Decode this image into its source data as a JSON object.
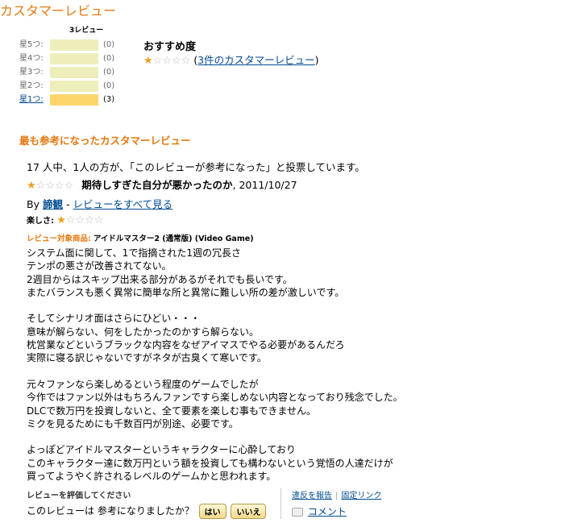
{
  "page": {
    "title": "カスタマーレビュー",
    "helpful_title": "最も参考になったカスタマーレビュー"
  },
  "histogram": {
    "header": "3レビュー",
    "rows": [
      {
        "label": "星5つ:",
        "count": "(0)",
        "fraction": 0
      },
      {
        "label": "星4つ:",
        "count": "(0)",
        "fraction": 0
      },
      {
        "label": "星3つ:",
        "count": "(0)",
        "fraction": 0
      },
      {
        "label": "星2つ:",
        "count": "(0)",
        "fraction": 0
      },
      {
        "label": "星1つ:",
        "count": "(3)",
        "fraction": 1
      }
    ]
  },
  "recommendation": {
    "title": "おすすめ度",
    "stars": 1,
    "max_stars": 5,
    "open_paren": "(",
    "link": "3件のカスタマーレビュー",
    "close_paren": ")"
  },
  "review": {
    "vote_summary": "17 人中、1人の方が、「このレビューが参考になった」と投票しています。",
    "stars": 1,
    "title": "期待しすぎた自分が悪かったのか",
    "date": ", 2011/10/27",
    "by": "By",
    "author": "諦観",
    "dash": " - ",
    "all_reviews_link": "レビューをすべて見る",
    "fun_label": "楽しさ:",
    "fun_stars": 1,
    "product_label": "レビュー対象商品:",
    "product_name": "アイドルマスター2 (通常版) (Video Game)",
    "body": [
      "システム面に関して、1で指摘された1週の冗長さ",
      "テンポの悪さが改善されてない。",
      "2週目からはスキップ出来る部分があるがそれでも長いです。",
      "またバランスも悪く異常に簡単な所と異常に難しい所の差が激しいです。",
      "",
      "そしてシナリオ面はさらにひどい・・・",
      "意味が解らない、何をしたかったのかすら解らない。",
      "枕営業などというブラックな内容をなぜアイマスでやる必要があるんだろ",
      "実際に寝る訳じゃないですがネタが古臭くて寒いです。",
      "",
      "元々ファンなら楽しめるという程度のゲームでしたが",
      "今作ではファン以外はもちろんファンですら楽しめない内容となっており残念でした。",
      "DLCで数万円を投資しないと、全て要素を楽しむ事もできません。",
      "ミクを見るためにも千数百円が別途、必要です。",
      "",
      "よっぽどアイドルマスターというキャラクターに心酔しており",
      "このキャラクター達に数万円という額を投資しても構わないという覚悟の人達だけが",
      "買ってようやく許されるレベルのゲームかと思われます。"
    ]
  },
  "footer": {
    "rate_label": "レビューを評価してください",
    "helpful_question": "このレビューは 参考になりましたか？",
    "yes": "はい",
    "no": "いいえ",
    "report_link": "違反を報告",
    "permalink": "固定リンク",
    "comment_link": "コメント"
  },
  "colors": {
    "accent": "#e47911",
    "link": "#004b91",
    "bar_empty": "#eeeebb",
    "bar_fill": "#fcd66b",
    "star": "#f0a020"
  },
  "icons": [
    "star-icon",
    "comment-icon"
  ]
}
